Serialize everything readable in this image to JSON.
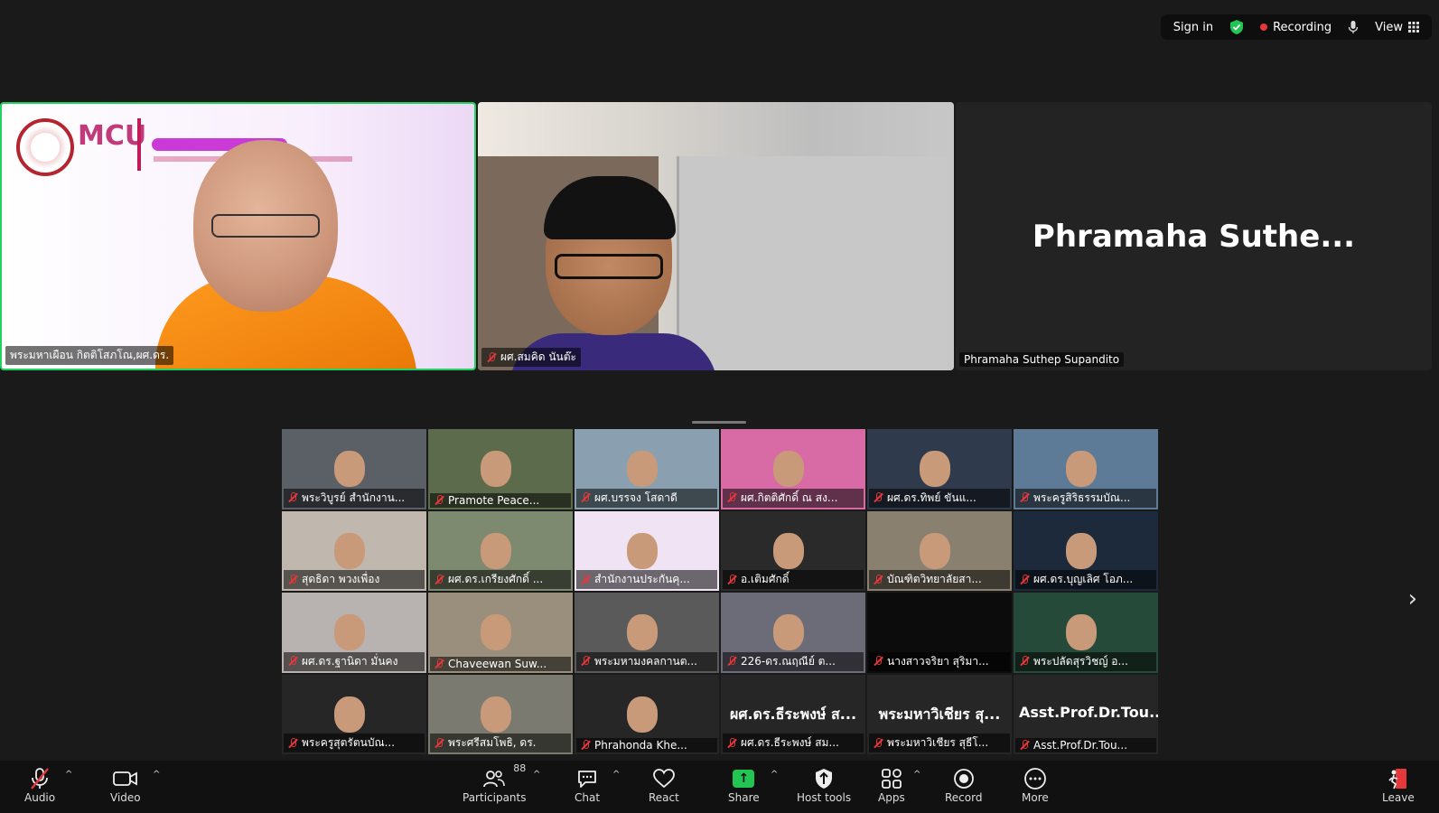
{
  "topbar": {
    "sign_in": "Sign in",
    "recording": "Recording",
    "view": "View"
  },
  "speakers": [
    {
      "name": "พระมหาเผือน กิตติโสภโณ,ผศ.ดร.",
      "active": true
    },
    {
      "name": "ผศ.สมคิด นันต๊ะ",
      "muted": true
    },
    {
      "name": "Phramaha Suthep Supandito",
      "display": "Phramaha  Suthe..."
    }
  ],
  "gallery": [
    {
      "name": "พระวิบูรย์ สำนักงาน..."
    },
    {
      "name": "Pramote Peace..."
    },
    {
      "name": "ผศ.บรรจง โสดาดี"
    },
    {
      "name": "ผศ.กิตติศักดิ์ ณ สง..."
    },
    {
      "name": "ผศ.ดร.ทิพย์ ขันแ..."
    },
    {
      "name": "พระครูสิริธรรมบัณ..."
    },
    {
      "name": "สุดธิดา พวงเพื่อง"
    },
    {
      "name": "ผศ.ดร.เกรียงศักดิ์ ..."
    },
    {
      "name": "สำนักงานประกันคุ..."
    },
    {
      "name": "อ.เติมศักดิ์"
    },
    {
      "name": "บัณฑิตวิทยาลัยสา..."
    },
    {
      "name": "ผศ.ดร.บุญเลิศ โอภ..."
    },
    {
      "name": "ผศ.ดร.ฐานิดา มั่นคง"
    },
    {
      "name": "Chaveewan Suw..."
    },
    {
      "name": "พระมหามงคลกานต..."
    },
    {
      "name": "226-ดร.ณฤณีย์ ต..."
    },
    {
      "name": "นางสาวจริยา สุริมา..."
    },
    {
      "name": "พระปลัดสุรวิชญ์ อ..."
    },
    {
      "name": "พระครูสุตรัตนบัณ..."
    },
    {
      "name": "พระศรีสมโพธิ, ดร."
    },
    {
      "name": "Phrahonda Khe..."
    },
    {
      "name": "ผศ.ดร.ธีระพงษ์ สม...",
      "big": "ผศ.ดร.ธีระพงษ์ ส..."
    },
    {
      "name": "พระมหาวิเชียร สุธีโ...",
      "big": "พระมหาวิเชียร สุ..."
    },
    {
      "name": "Asst.Prof.Dr.Tou...",
      "big": "Asst.Prof.Dr.Tou..."
    }
  ],
  "toolbar": {
    "audio": "Audio",
    "video": "Video",
    "participants": "Participants",
    "participants_count": "88",
    "chat": "Chat",
    "react": "React",
    "share": "Share",
    "host_tools": "Host tools",
    "apps": "Apps",
    "record": "Record",
    "more": "More",
    "leave": "Leave"
  },
  "colors": {
    "active_border": "#23d160",
    "muted_red": "#e5383b",
    "share_green": "#23c552",
    "toolbar_bg": "#111111"
  }
}
